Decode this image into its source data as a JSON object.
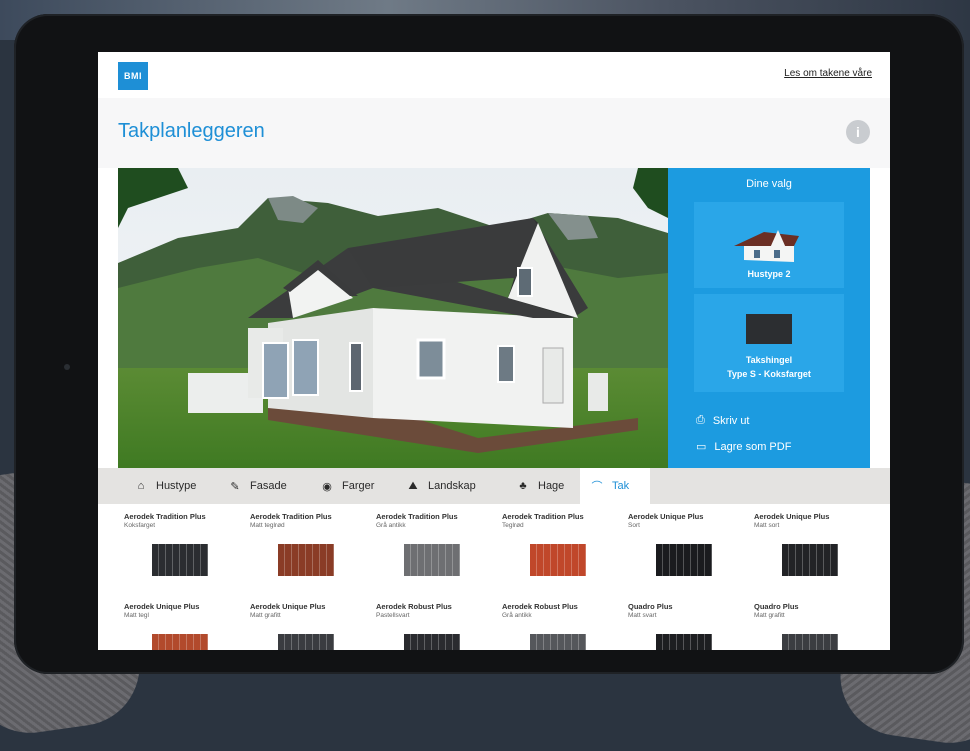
{
  "header": {
    "logo_text": "BMI",
    "about_link": "Les om takene våre"
  },
  "app": {
    "title": "Takplanleggeren",
    "info_icon": "i"
  },
  "selection_panel": {
    "title": "Dine valg",
    "house_type_label": "Hustype 2",
    "roof_label_line1": "Takshingel",
    "roof_label_line2": "Type S - Koksfarget",
    "print_label": "Skriv ut",
    "pdf_label": "Lagre som PDF",
    "accent_color": "#1c9be0"
  },
  "tabs": [
    {
      "label": "Hustype",
      "icon": "house-icon",
      "glyph": "⌂"
    },
    {
      "label": "Fasade",
      "icon": "brush-icon",
      "glyph": "✎"
    },
    {
      "label": "Farger",
      "icon": "palette-icon",
      "glyph": "◉"
    },
    {
      "label": "Landskap",
      "icon": "landscape-icon",
      "glyph": "⛰"
    },
    {
      "label": "Hage",
      "icon": "tree-icon",
      "glyph": "♣"
    },
    {
      "label": "Tak",
      "icon": "roof-icon",
      "glyph": "⌒",
      "active": true
    }
  ],
  "products": [
    {
      "name": "Aerodek Tradition Plus",
      "color": "Koksfarget",
      "swatch": "#2b2d31"
    },
    {
      "name": "Aerodek Tradition Plus",
      "color": "Matt teglrød",
      "swatch": "#8a3c26"
    },
    {
      "name": "Aerodek Tradition Plus",
      "color": "Grå antikk",
      "swatch": "#6e6f72"
    },
    {
      "name": "Aerodek Tradition Plus",
      "color": "Teglrød",
      "swatch": "#c0472a"
    },
    {
      "name": "Aerodek Unique Plus",
      "color": "Sort",
      "swatch": "#1a1b1e"
    },
    {
      "name": "Aerodek Unique Plus",
      "color": "Matt sort",
      "swatch": "#222326"
    },
    {
      "name": "Aerodek Unique Plus",
      "color": "Matt tegl",
      "swatch": "#b24a2c"
    },
    {
      "name": "Aerodek Unique Plus",
      "color": "Matt grafitt",
      "swatch": "#3a3c40"
    },
    {
      "name": "Aerodek Robust Plus",
      "color": "Pastellsvart",
      "swatch": "#2a2b2f"
    },
    {
      "name": "Aerodek Robust Plus",
      "color": "Grå antikk",
      "swatch": "#55575b"
    },
    {
      "name": "Quadro Plus",
      "color": "Matt svart",
      "swatch": "#1d1e21"
    },
    {
      "name": "Quadro Plus",
      "color": "Matt grafitt",
      "swatch": "#3b3d41"
    }
  ]
}
